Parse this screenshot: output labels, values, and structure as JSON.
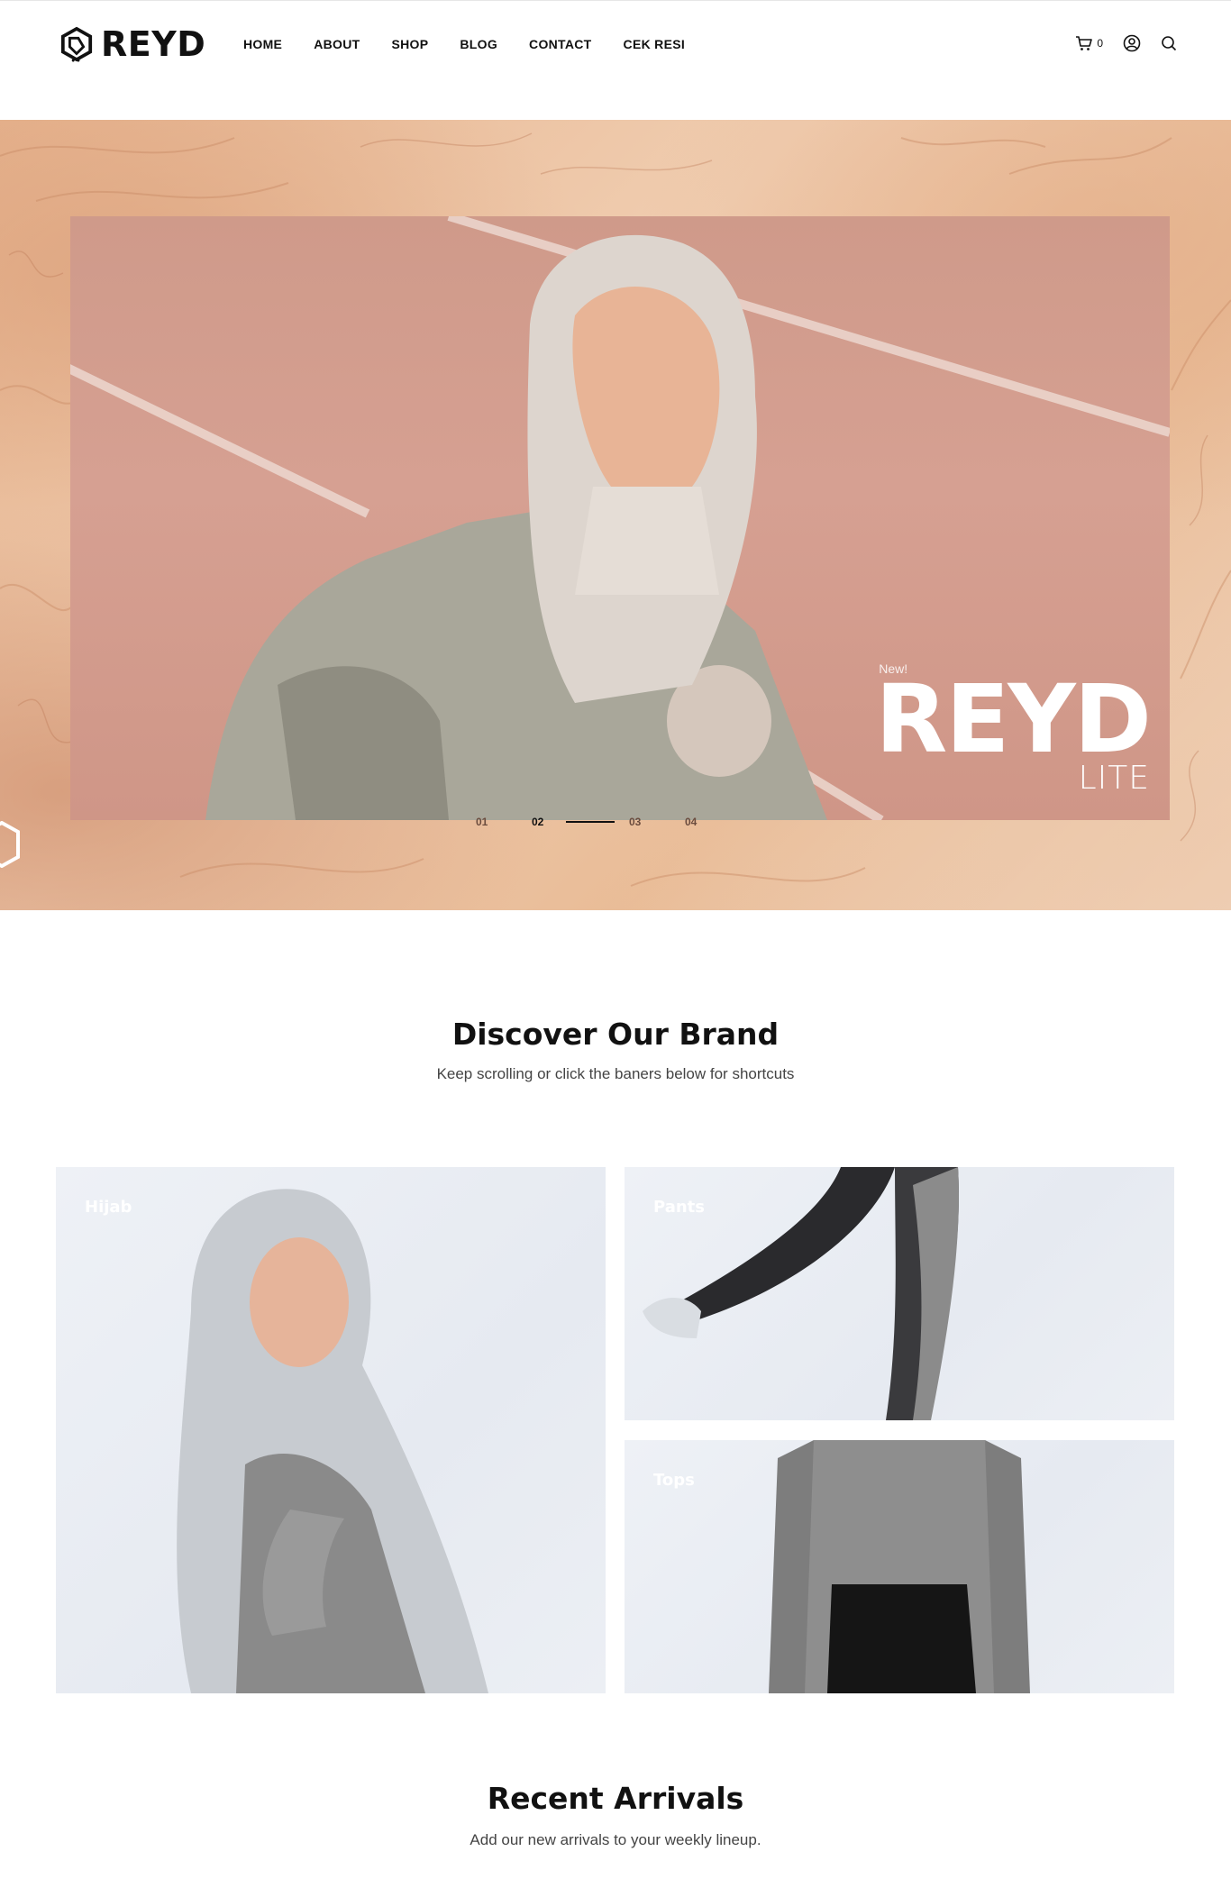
{
  "header": {
    "logo_text": "REYD",
    "nav": [
      "HOME",
      "ABOUT",
      "SHOP",
      "BLOG",
      "CONTACT",
      "CEK RESI"
    ],
    "cart_count": "0",
    "icons": [
      "cart-icon",
      "user-icon",
      "search-icon"
    ]
  },
  "hero": {
    "tag": "New!",
    "brand": "REYD",
    "sub": "LITE",
    "pager": [
      "01",
      "02",
      "03",
      "04"
    ],
    "active_slide": "02"
  },
  "discover": {
    "title": "Discover Our Brand",
    "subtitle": "Keep scrolling or click the baners below for shortcuts",
    "tiles": [
      "Hijab",
      "Pants",
      "Tops"
    ]
  },
  "recent": {
    "title": "Recent Arrivals",
    "subtitle": "Add our new arrivals to your weekly lineup."
  },
  "colors": {
    "accent": "#111111",
    "hero_bg": "#e7b590",
    "tile_bg": "#eceff4"
  }
}
